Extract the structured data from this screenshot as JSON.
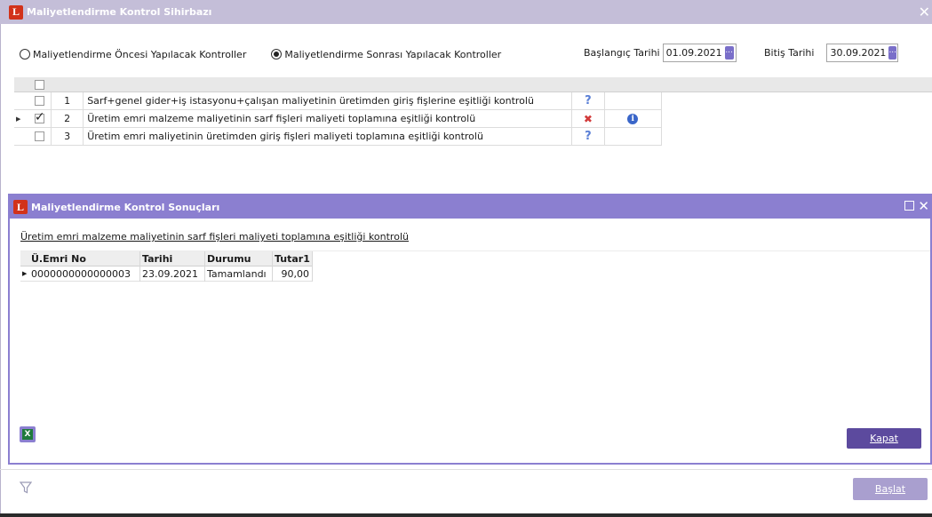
{
  "window": {
    "title": "Maliyetlendirme Kontrol Sihirbazı"
  },
  "options": {
    "before_label": "Maliyetlendirme Öncesi Yapılacak Kontroller",
    "after_label": "Maliyetlendirme Sonrası Yapılacak Kontroller",
    "selected": "after"
  },
  "dates": {
    "start_label": "Başlangıç Tarihi",
    "start_value": "01.09.2021",
    "end_label": "Bitiş Tarihi",
    "end_value": "30.09.2021",
    "picker_glyph": "..."
  },
  "checks": [
    {
      "no": "1",
      "text": "Sarf+genel gider+iş istasyonu+çalışan maliyetinin üretimden giriş fişlerine eşitliği kontrolü",
      "checked": false,
      "status": "?",
      "status_icon": "question-icon",
      "info": ""
    },
    {
      "no": "2",
      "text": "Üretim emri malzeme maliyetinin sarf fişleri maliyeti toplamına eşitliği kontrolü",
      "checked": true,
      "status": "✖",
      "status_icon": "error-x-icon",
      "info": "i"
    },
    {
      "no": "3",
      "text": "Üretim emri maliyetinin üretimden giriş fişleri maliyeti toplamına eşitliği kontrolü",
      "checked": false,
      "status": "?",
      "status_icon": "question-icon",
      "info": ""
    }
  ],
  "results": {
    "title": "Maliyetlendirme Kontrol Sonuçları",
    "check_title": "Üretim emri malzeme maliyetinin sarf fişleri maliyeti toplamına eşitliği kontrolü",
    "columns": [
      "Ü.Emri No",
      "Tarihi",
      "Durumu",
      "Tutar1"
    ],
    "rows": [
      [
        "0000000000000003",
        "23.09.2021",
        "Tamamlandı",
        "90,00"
      ]
    ],
    "close_label": "Kapat"
  },
  "footer": {
    "start_label": "Başlat"
  },
  "colors": {
    "accent": "#8b7fd0",
    "title_bar": "#c4bed8",
    "logo": "#d2321a",
    "error": "#d23a3a",
    "question": "#5a7fd6"
  }
}
